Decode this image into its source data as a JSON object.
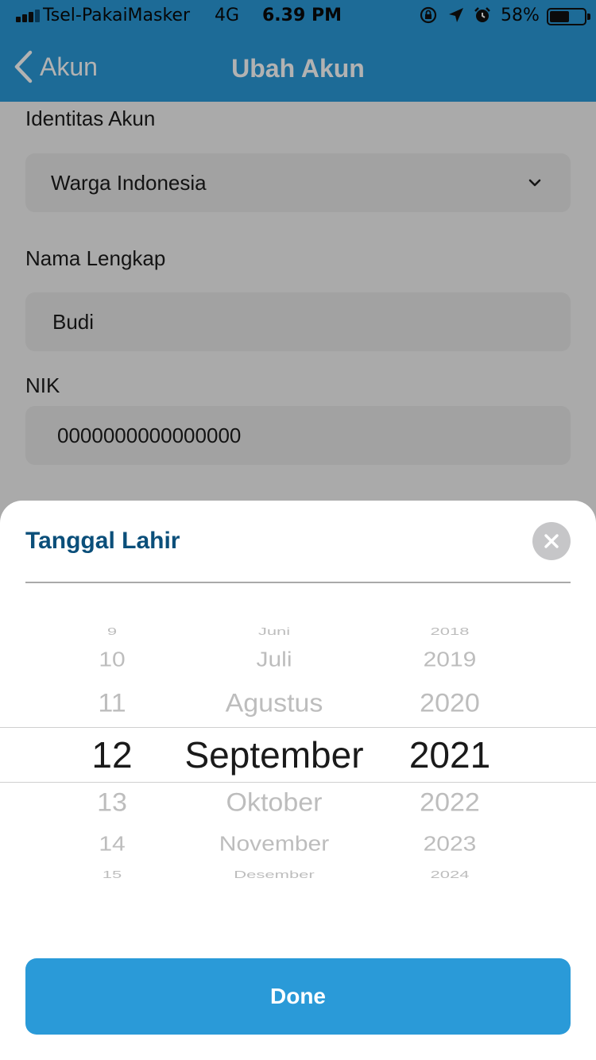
{
  "status_bar": {
    "carrier": "Tsel-PakaiMasker",
    "network": "4G",
    "time": "6.39 PM",
    "battery_percent": "58%",
    "battery_level": 0.58,
    "icons": [
      "signal-icon",
      "orientation-lock-icon",
      "location-icon",
      "alarm-icon",
      "battery-icon"
    ]
  },
  "nav": {
    "back_label": "Akun",
    "title": "Ubah Akun"
  },
  "form": {
    "identity": {
      "label": "Identitas Akun",
      "value": "Warga Indonesia"
    },
    "name": {
      "label": "Nama Lengkap",
      "value": "Budi"
    },
    "nik": {
      "label": "NIK",
      "value": "0000000000000000"
    }
  },
  "sheet": {
    "title": "Tanggal Lahir",
    "close_icon": "close-icon",
    "done_label": "Done"
  },
  "picker": {
    "days": [
      "9",
      "10",
      "11",
      "12",
      "13",
      "14",
      "15"
    ],
    "months": [
      "Juni",
      "Juli",
      "Agustus",
      "September",
      "Oktober",
      "November",
      "Desember"
    ],
    "years": [
      "2018",
      "2019",
      "2020",
      "2021",
      "2022",
      "2023",
      "2024"
    ],
    "selected": {
      "day": "12",
      "month": "September",
      "year": "2021"
    }
  },
  "colors": {
    "accent": "#2a9ad8",
    "sheet_title": "#0b4f7a",
    "field_bg": "#e8e8e8"
  }
}
